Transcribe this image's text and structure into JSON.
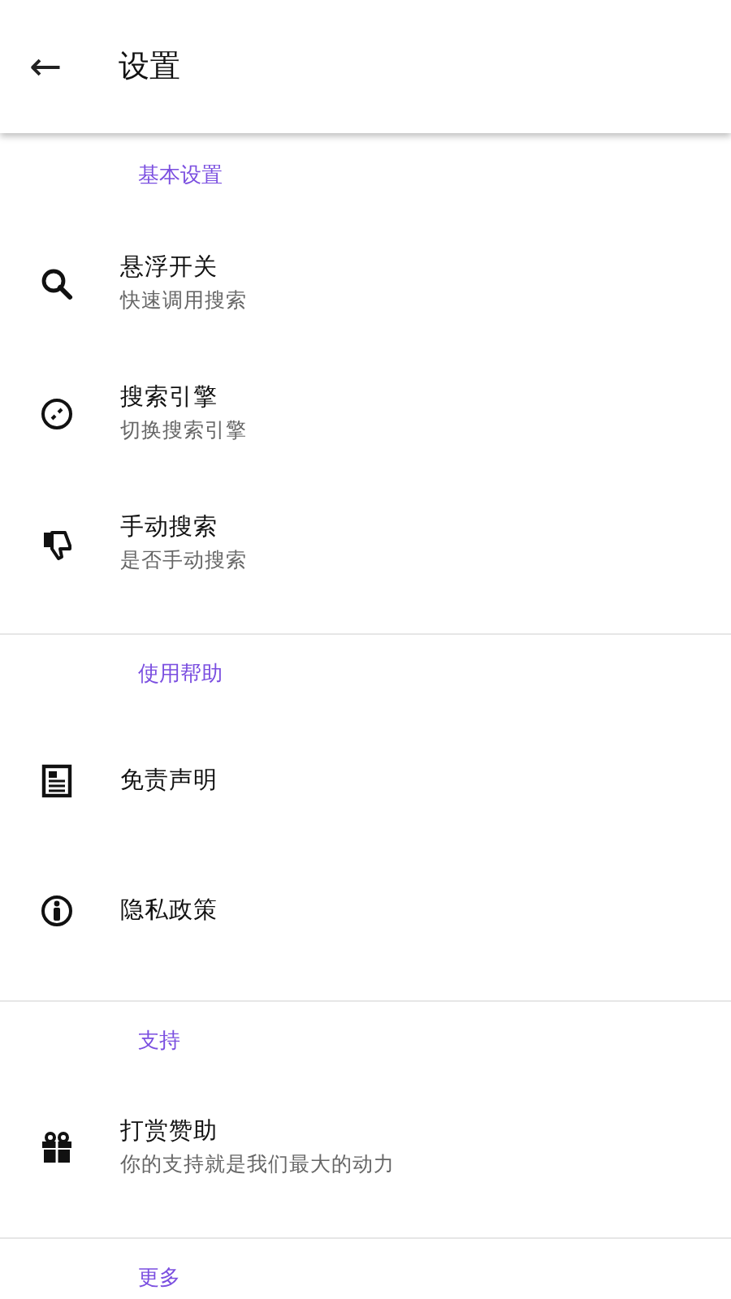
{
  "app_bar": {
    "back_icon": "←",
    "title": "设置"
  },
  "sections": [
    {
      "header": "基本设置",
      "items": [
        {
          "title": "悬浮开关",
          "subtitle": "快速调用搜索"
        },
        {
          "title": "搜索引擎",
          "subtitle": "切换搜索引擎"
        },
        {
          "title": "手动搜索",
          "subtitle": "是否手动搜索"
        }
      ]
    },
    {
      "header": "使用帮助",
      "items": [
        {
          "title": "免责声明"
        },
        {
          "title": "隐私政策"
        }
      ]
    },
    {
      "header": "支持",
      "items": [
        {
          "title": "打赏赞助",
          "subtitle": "你的支持就是我们最大的动力"
        }
      ]
    },
    {
      "header": "更多"
    }
  ]
}
